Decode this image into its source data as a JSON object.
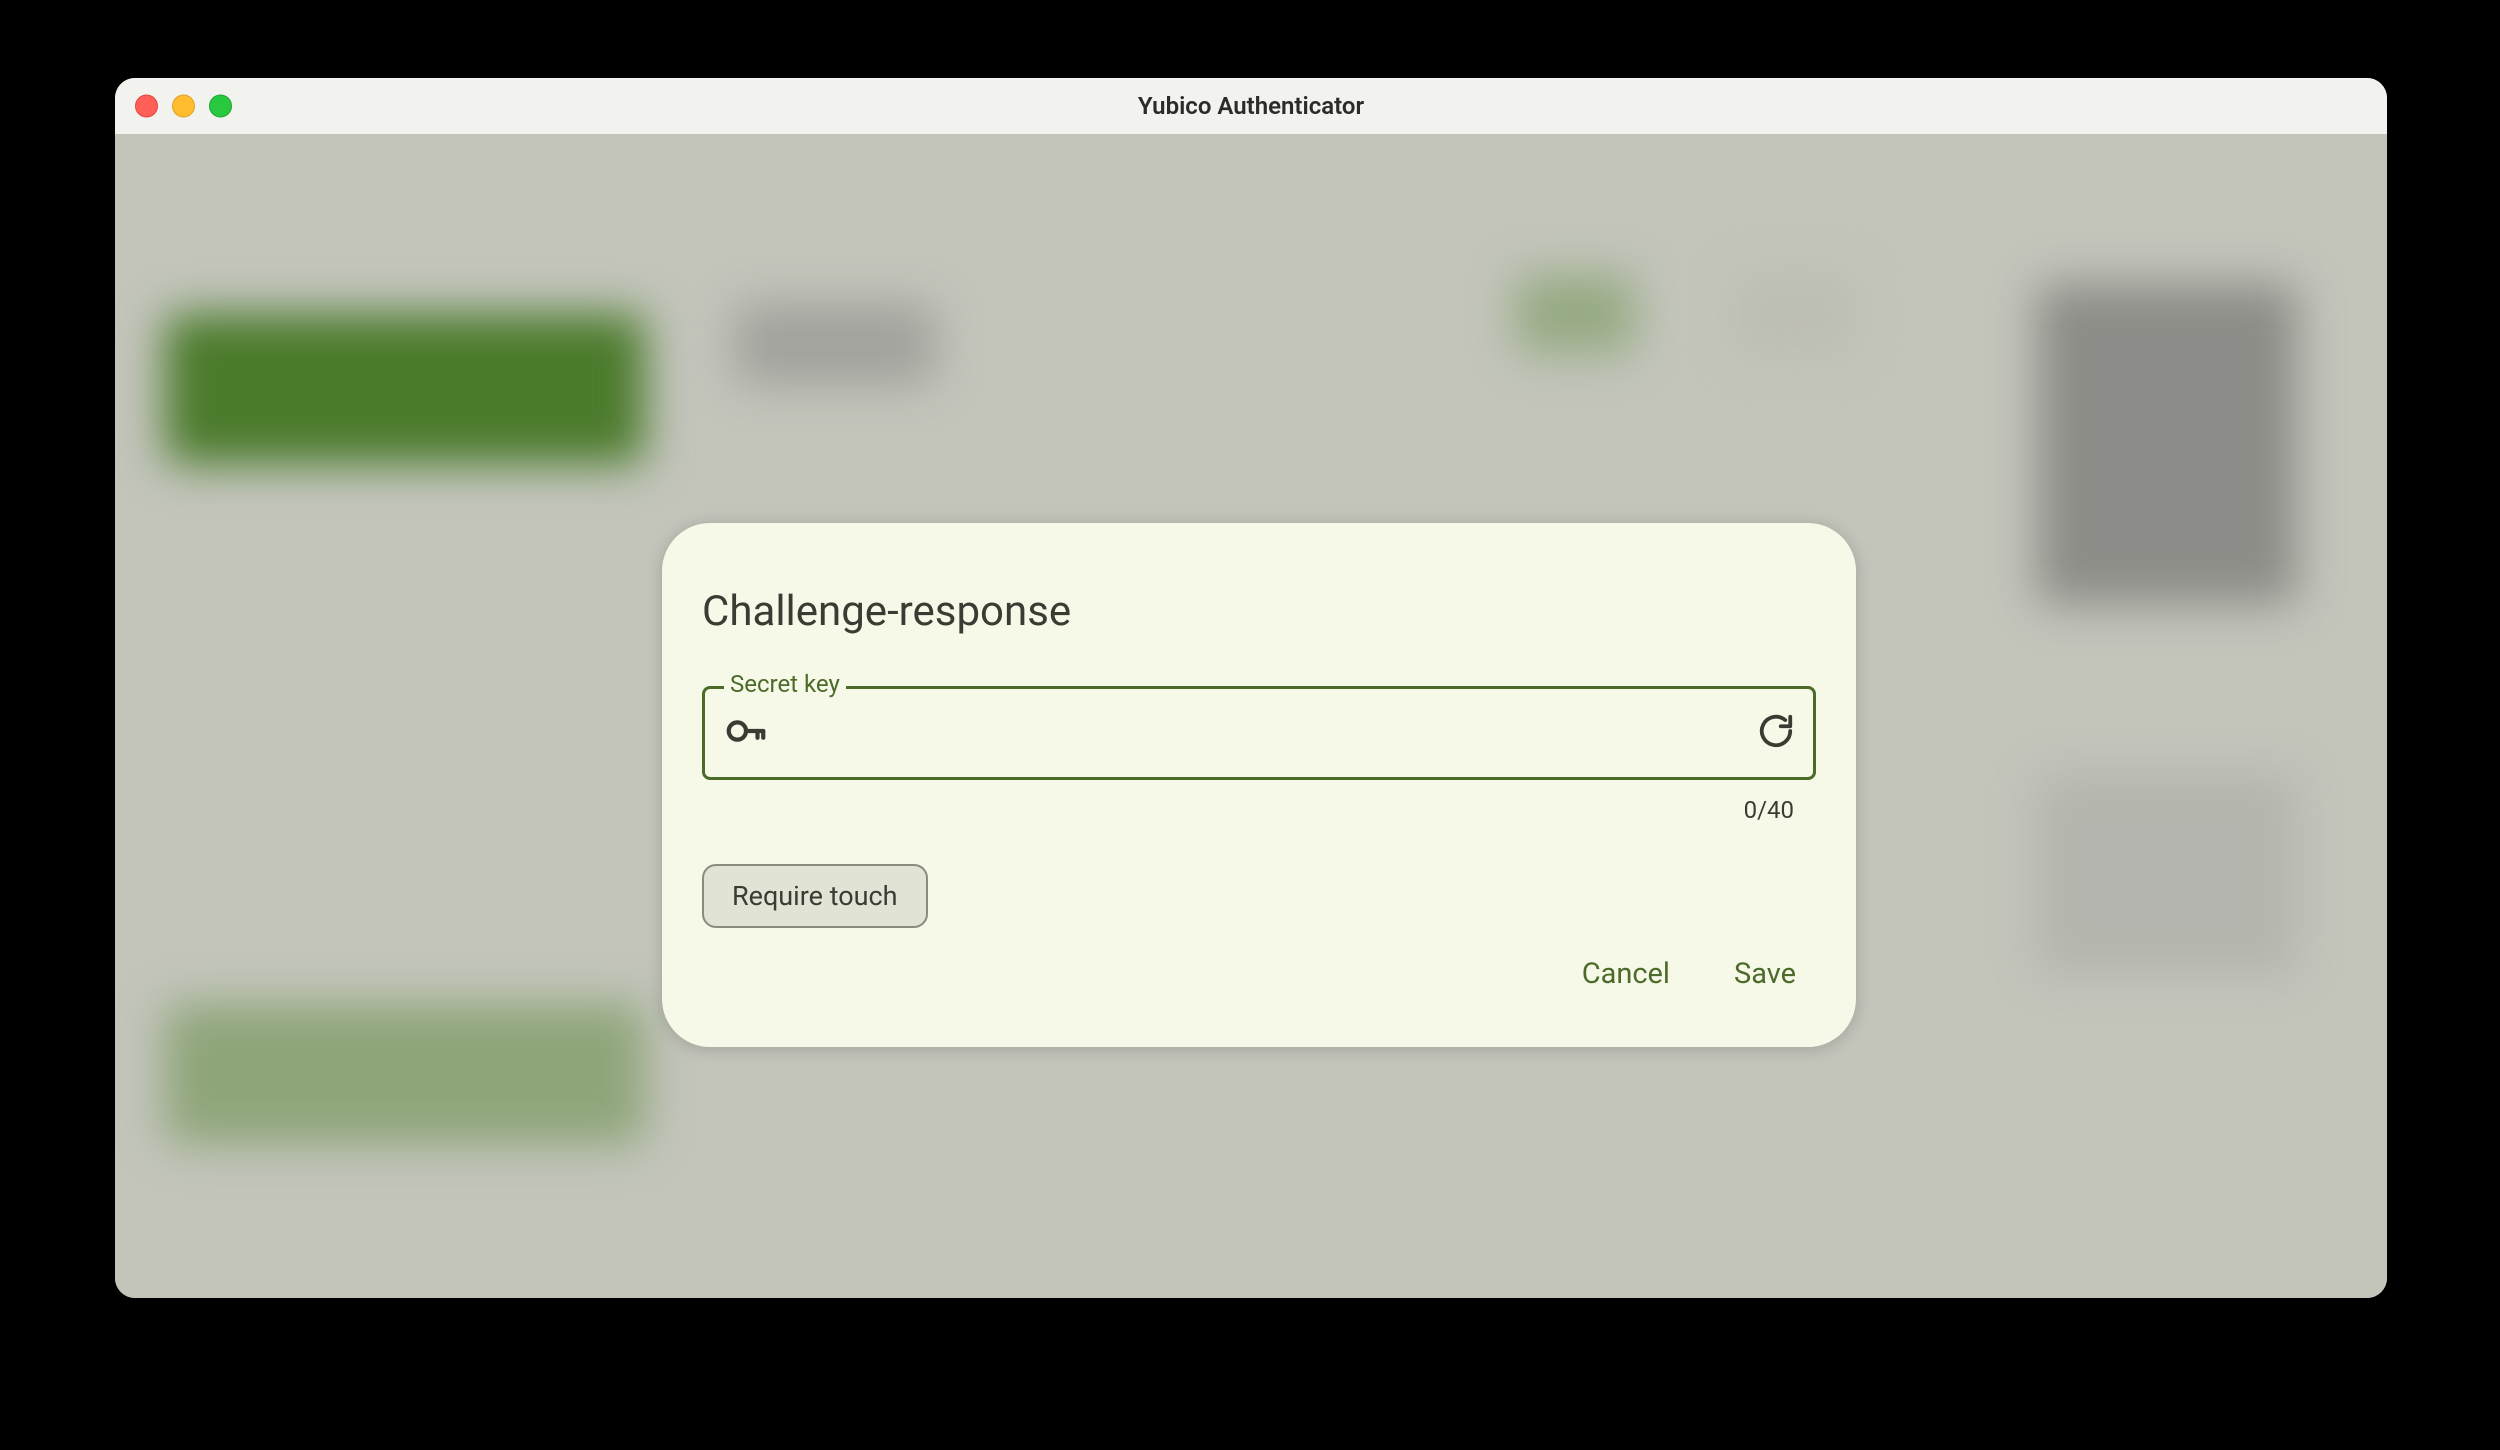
{
  "window": {
    "title": "Yubico Authenticator"
  },
  "dialog": {
    "title": "Challenge-response",
    "field_label": "Secret key",
    "field_value": "",
    "char_count": "0/40",
    "chip_label": "Require touch",
    "cancel_label": "Cancel",
    "save_label": "Save"
  }
}
